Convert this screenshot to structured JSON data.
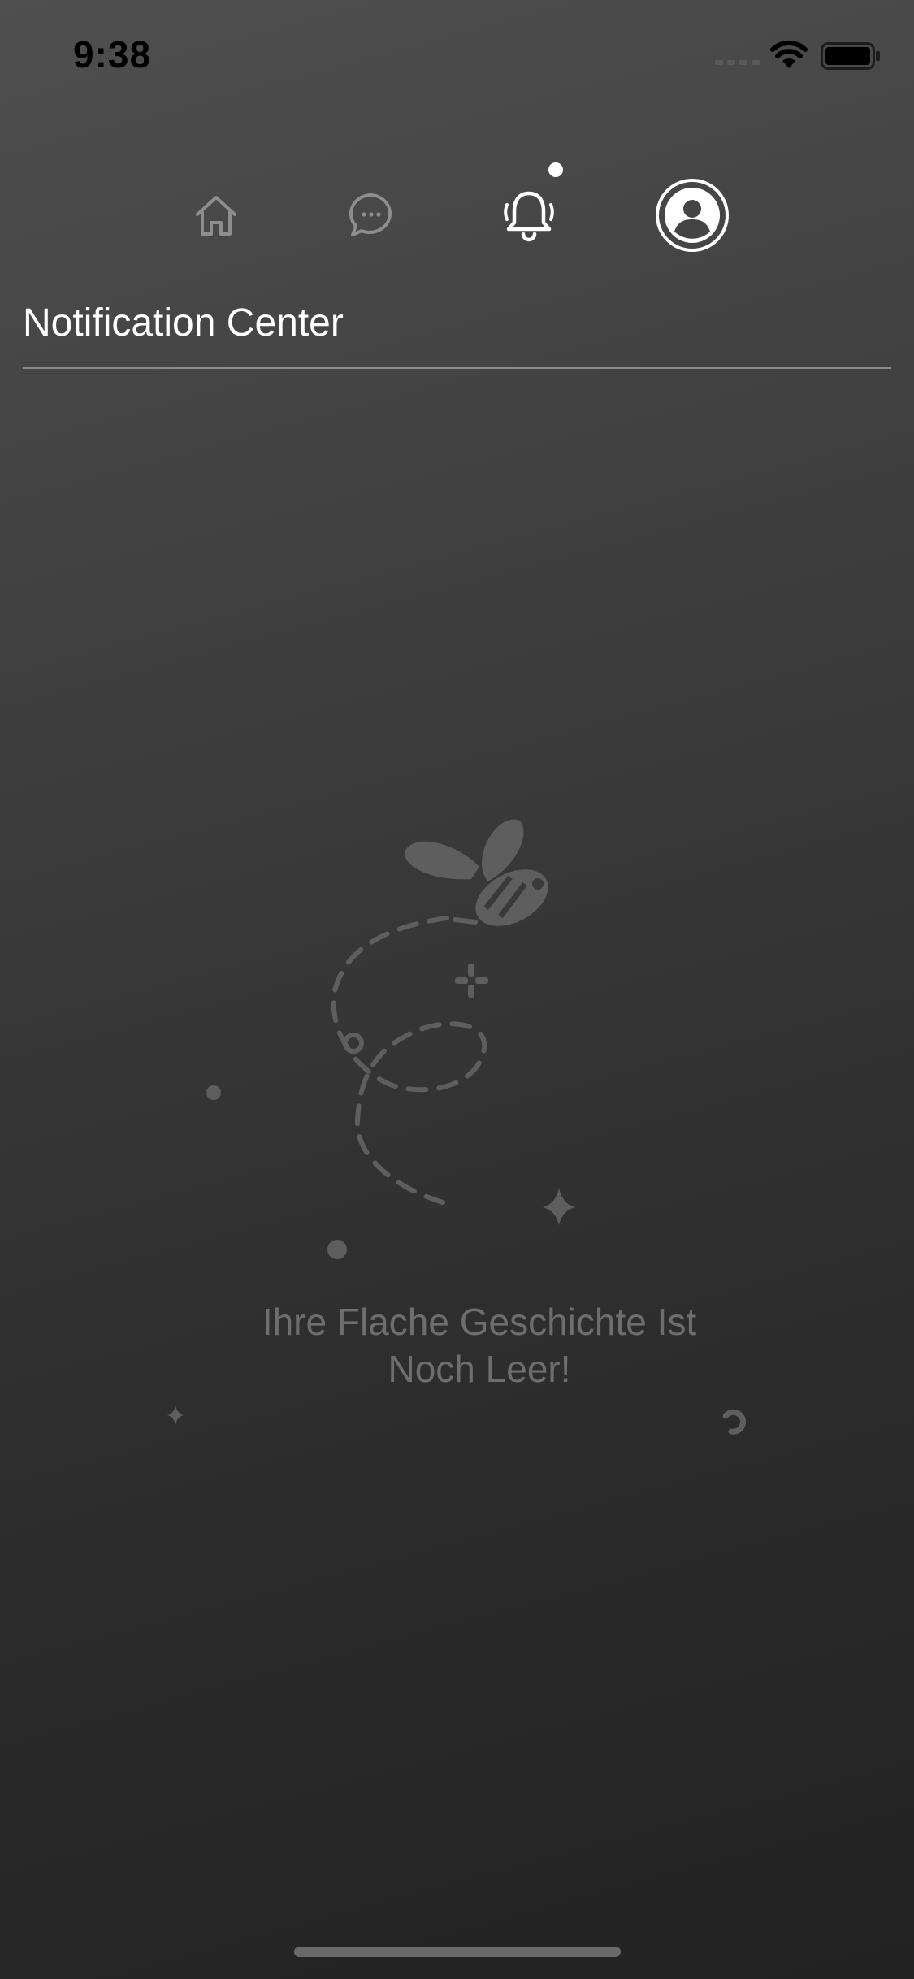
{
  "status_bar": {
    "time": "9:38",
    "icons": [
      "cellular-signal-icon",
      "wifi-icon",
      "battery-icon"
    ]
  },
  "nav": {
    "items": [
      {
        "name": "home",
        "icon": "home-icon",
        "active": false
      },
      {
        "name": "messages",
        "icon": "chat-bubble-icon",
        "active": false
      },
      {
        "name": "notifications",
        "icon": "bell-icon",
        "active": true,
        "badge": true
      },
      {
        "name": "profile",
        "icon": "user-avatar-icon",
        "active": true
      }
    ]
  },
  "header": {
    "title": "Notification Center"
  },
  "empty_state": {
    "illustration": "bee-icon",
    "line1": "Ihre Flache Geschichte Ist",
    "line2": "Noch Leer!"
  },
  "colors": {
    "background_top": "#4f4f4f",
    "background_bottom": "#222222",
    "active_icon": "#ffffff",
    "inactive_icon": "#8e8e8e",
    "empty_text": "#6e6e6e"
  }
}
